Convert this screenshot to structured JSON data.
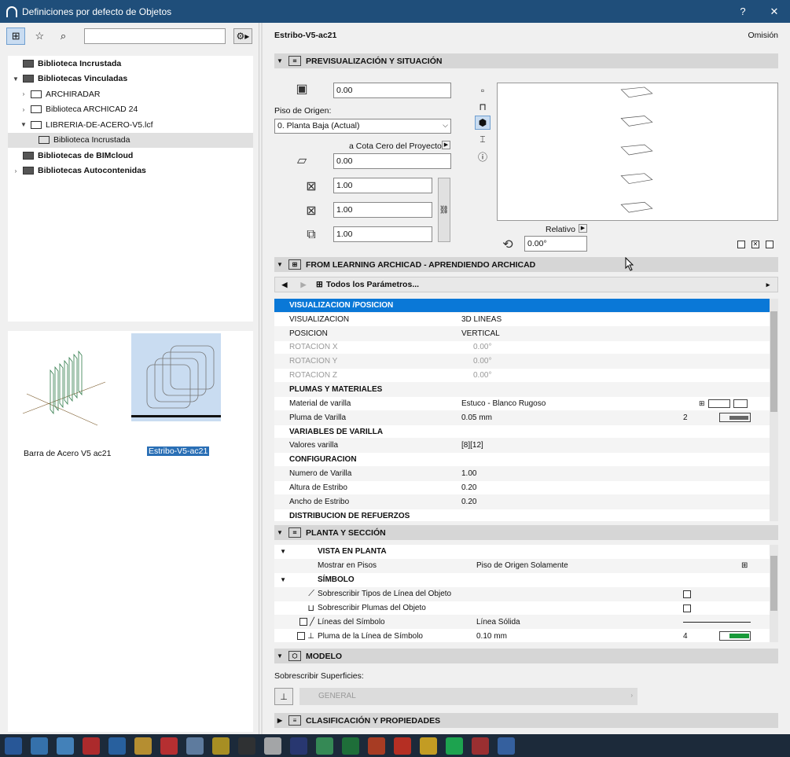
{
  "window": {
    "title": "Definiciones por defecto de Objetos",
    "help": "?",
    "close": "✕"
  },
  "left": {
    "search_placeholder": "",
    "tree": [
      {
        "label": "Biblioteca Incrustada",
        "bold": true,
        "level": 0,
        "twist": ""
      },
      {
        "label": "Bibliotecas Vinculadas",
        "bold": true,
        "level": 0,
        "twist": "▼"
      },
      {
        "label": "ARCHIRADAR",
        "bold": false,
        "level": 1,
        "twist": "›"
      },
      {
        "label": "Biblioteca ARCHICAD 24",
        "bold": false,
        "level": 1,
        "twist": "›"
      },
      {
        "label": "LIBRERIA-DE-ACERO-V5.lcf",
        "bold": false,
        "level": 1,
        "twist": "▼"
      },
      {
        "label": "Biblioteca Incrustada",
        "bold": false,
        "level": 2,
        "twist": "",
        "selected": true
      },
      {
        "label": "Bibliotecas de BIMcloud",
        "bold": true,
        "level": 0,
        "twist": ""
      },
      {
        "label": "Bibliotecas Autocontenidas",
        "bold": true,
        "level": 0,
        "twist": "›"
      }
    ],
    "thumbs": [
      {
        "label": "Barra de Acero V5 ac21"
      },
      {
        "label": "Estribo-V5-ac21"
      }
    ]
  },
  "right": {
    "object_name": "Estribo-V5-ac21",
    "omission": "Omisión",
    "sections": {
      "preview": "PREVISUALIZACIÓN Y SITUACIÓN",
      "learning": "FROM LEARNING ARCHICAD  - APRENDIENDO ARCHICAD",
      "plant": "PLANTA Y SECCIÓN",
      "model": "MODELO",
      "classif": "CLASIFICACIÓN Y PROPIEDADES"
    },
    "preview": {
      "elev_value": "0.00",
      "piso_label": "Piso de Origen:",
      "piso_value": "0. Planta Baja (Actual)",
      "cota_label": "a Cota Cero del Proyecto",
      "cota_value": "0.00",
      "x_value": "1.00",
      "y_value": "1.00",
      "z_value": "1.00",
      "relativo": "Relativo",
      "angle": "0.00°"
    },
    "params_nav": "Todos los Parámetros...",
    "params": [
      {
        "name": "VISUALIZACION /POSICION",
        "value": "",
        "type": "head"
      },
      {
        "name": "VISUALIZACION",
        "value": "3D LINEAS",
        "type": "row"
      },
      {
        "name": "POSICION",
        "value": "VERTICAL",
        "type": "row"
      },
      {
        "name": "ROTACION X",
        "value": "0.00°",
        "type": "dis"
      },
      {
        "name": "ROTACION Y",
        "value": "0.00°",
        "type": "dis"
      },
      {
        "name": "ROTACION Z",
        "value": "0.00°",
        "type": "dis"
      },
      {
        "name": "PLUMAS Y MATERIALES",
        "value": "",
        "type": "grp"
      },
      {
        "name": "Material de varilla",
        "value": "Estuco - Blanco Rugoso",
        "type": "row"
      },
      {
        "name": "Pluma de Varilla",
        "value": "0.05 mm",
        "type": "row",
        "extra": "2"
      },
      {
        "name": "VARIABLES DE VARILLA",
        "value": "",
        "type": "grp"
      },
      {
        "name": "Valores varilla",
        "value": "[8][12]",
        "type": "row"
      },
      {
        "name": "CONFIGURACION",
        "value": "",
        "type": "grp"
      },
      {
        "name": "Numero de  Varilla",
        "value": "1.00",
        "type": "row"
      },
      {
        "name": "Altura de Estribo",
        "value": "0.20",
        "type": "row"
      },
      {
        "name": "Ancho de Estribo",
        "value": "0.20",
        "type": "row"
      },
      {
        "name": "DISTRIBUCION DE REFUERZOS",
        "value": "",
        "type": "grp"
      }
    ],
    "plant": [
      {
        "name": "VISTA EN PLANTA",
        "value": "",
        "type": "grp"
      },
      {
        "name": "Mostrar en Pisos",
        "value": "Piso de Origen Solamente",
        "type": "row"
      },
      {
        "name": "SÍMBOLO",
        "value": "",
        "type": "grp"
      },
      {
        "name": "Sobrescribir Tipos de Línea del Objeto",
        "value": "",
        "type": "chk"
      },
      {
        "name": "Sobrescribir Plumas del Objeto",
        "value": "",
        "type": "chk"
      },
      {
        "name": "Líneas del Símbolo",
        "value": "Línea Sólida",
        "type": "line"
      },
      {
        "name": "Pluma de la Línea de Símbolo",
        "value": "0.10 mm",
        "type": "pen",
        "extra": "4"
      }
    ],
    "model": {
      "surf_label": "Sobrescribir Superficies:",
      "general": "GENERAL"
    }
  },
  "colors": {
    "titlebar": "#1f4e7a",
    "selection": "#0a78d7",
    "pen_green": "#1a9a3a"
  }
}
